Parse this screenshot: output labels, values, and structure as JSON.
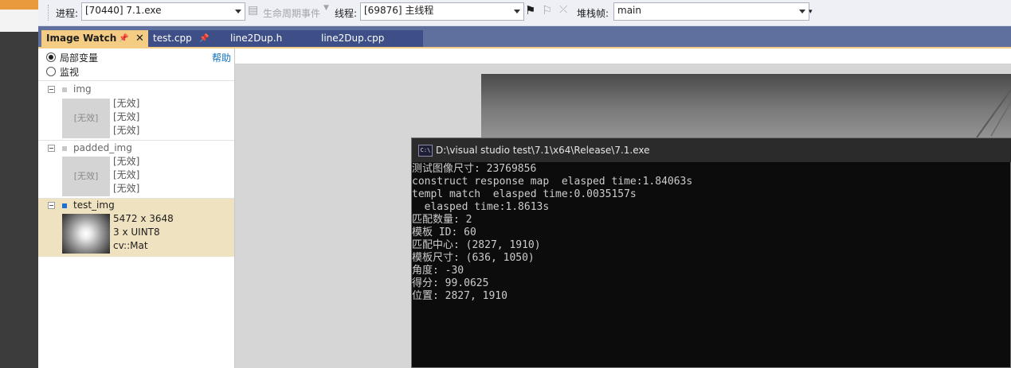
{
  "toolbar": {
    "process_label": "进程:",
    "process_value": "[70440] 7.1.exe",
    "lifecycle_label": "生命周期事件",
    "thread_label": "线程:",
    "thread_value": "[69876] 主线程",
    "stack_label": "堆栈帧:",
    "stack_value": "main"
  },
  "tabs": [
    {
      "label": "Image Watch",
      "active": true
    },
    {
      "label": "test.cpp",
      "active": false
    },
    {
      "label": "line2Dup.h",
      "active": false
    },
    {
      "label": "line2Dup.cpp",
      "active": false
    }
  ],
  "image_watch": {
    "locals_label": "局部变量",
    "watch_label": "监视",
    "help_label": "帮助",
    "items": [
      {
        "name": "img",
        "thumb_text": "[无效]",
        "info": [
          "[无效]",
          "[无效]",
          "[无效]"
        ]
      },
      {
        "name": "padded_img",
        "thumb_text": "[无效]",
        "info": [
          "[无效]",
          "[无效]",
          "[无效]"
        ]
      },
      {
        "name": "test_img",
        "info": [
          "5472 x 3648",
          "3 x UINT8",
          "cv::Mat"
        ]
      }
    ]
  },
  "console": {
    "title": "D:\\visual studio test\\7.1\\x64\\Release\\7.1.exe",
    "icon_text": "C:\\",
    "lines": [
      "测试图像尺寸: 23769856",
      "construct response map  elasped time:1.84063s",
      "templ match  elasped time:0.0035157s",
      "  elasped time:1.8613s",
      "匹配数量: 2",
      "模板 ID: 60",
      "匹配中心: (2827, 1910)",
      "模板尺寸: (636, 1050)",
      "角度: -30",
      "得分: 99.0625",
      "位置: 2827, 1910"
    ]
  }
}
